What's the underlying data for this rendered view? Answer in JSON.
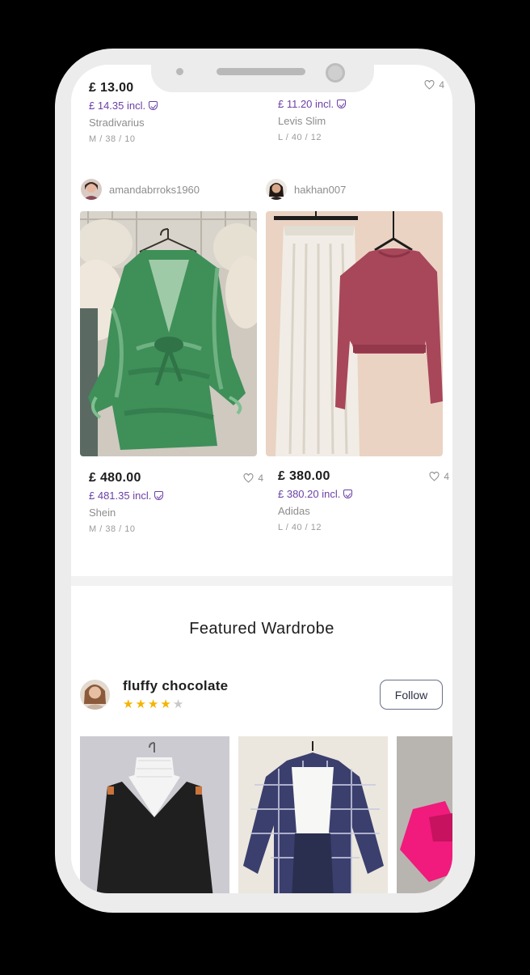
{
  "top_row": {
    "left": {
      "price": "£ 13.00",
      "incl": "£ 14.35 incl.",
      "brand": "Stradivarius",
      "size": "M / 38 / 10"
    },
    "right": {
      "incl": "£ 11.20 incl.",
      "brand": "Levis Slim",
      "size": "L / 40 / 12",
      "likes": "4"
    }
  },
  "listings": [
    {
      "seller": "amandabrroks1960",
      "price": "£ 480.00",
      "incl": "£ 481.35 incl.",
      "brand": "Shein",
      "size": "M / 38 / 10",
      "likes": "4"
    },
    {
      "seller": "hakhan007",
      "price": "£ 380.00",
      "incl": "£ 380.20 incl.",
      "brand": "Adidas",
      "size": "L / 40 / 12",
      "likes": "4"
    }
  ],
  "featured": {
    "title": "Featured Wardrobe",
    "username": "fluffy chocolate",
    "rating": 4,
    "rating_max": 5,
    "follow_label": "Follow"
  },
  "colors": {
    "accent_purple": "#6b3fa6",
    "star": "#f4b400"
  }
}
